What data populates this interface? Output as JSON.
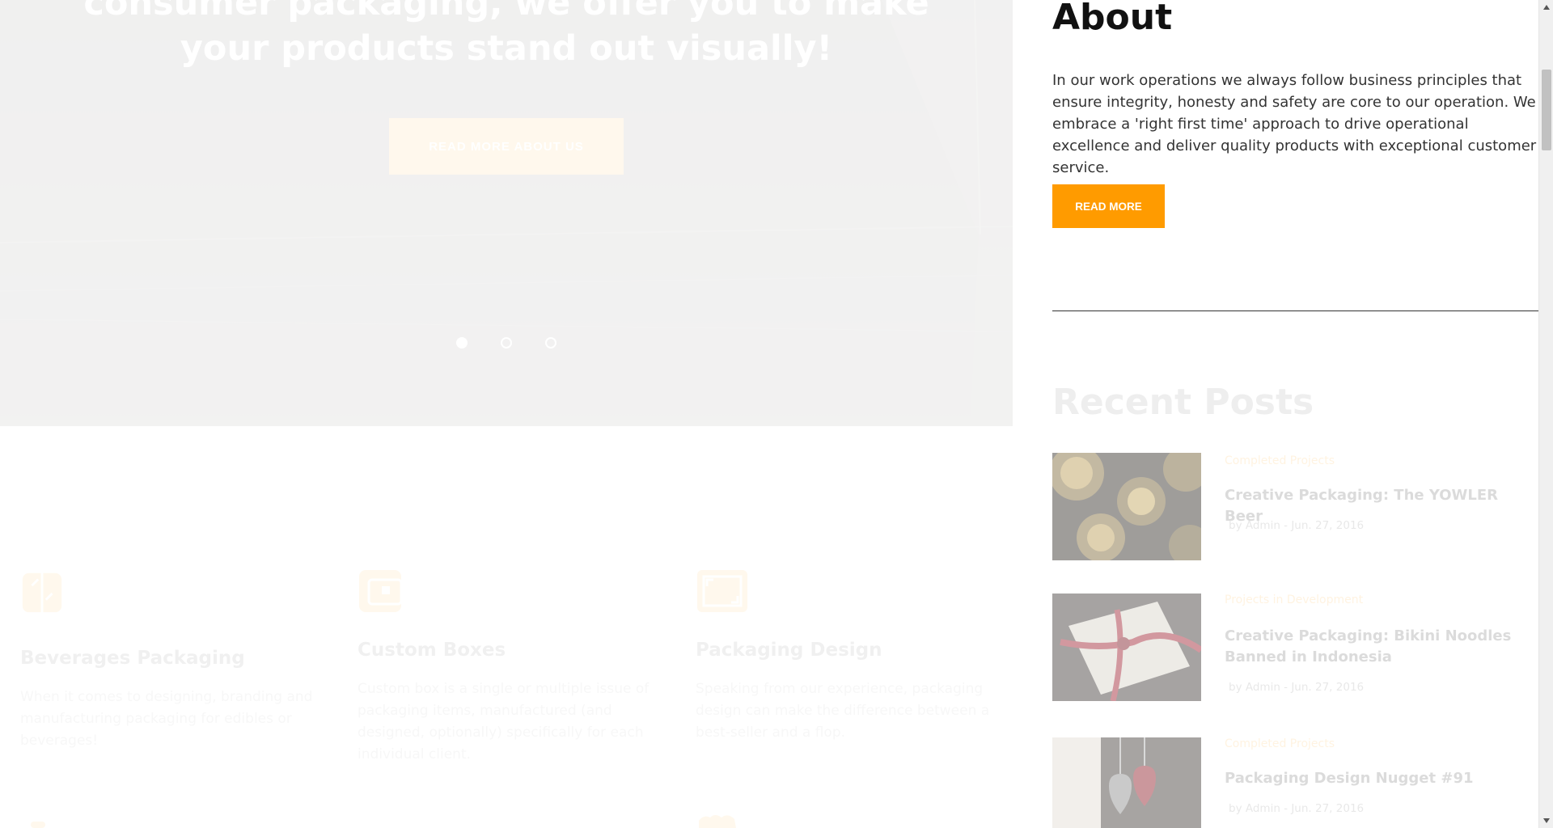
{
  "hero": {
    "heading": "consumer packaging, we offer you to make your products stand out visually!",
    "button_label": "READ MORE ABOUT US",
    "slides": [
      {
        "active": true
      },
      {
        "active": false
      },
      {
        "active": false
      }
    ]
  },
  "services": [
    {
      "icon": "beverage-icon",
      "title": "Beverages Packaging",
      "text": "When it comes to designing, branding and manufacturing packaging for edibles or beverages!"
    },
    {
      "icon": "wallet-box-icon",
      "title": "Custom Boxes",
      "text": "Custom box is a single or multiple issue of packaging items, manufactured (and designed, optionally) specifically for each individual client."
    },
    {
      "icon": "frame-design-icon",
      "title": "Packaging Design",
      "text": "Speaking from our experience, packaging design can make the difference between a best-seller and a flop."
    }
  ],
  "about": {
    "title": "About",
    "text": "In our work operations we always follow business principles that ensure integrity, honesty and safety are core to our operation. We embrace a 'right first time' approach to drive operational excellence and deliver quality products with exceptional customer service.",
    "button_label": "READ MORE"
  },
  "recent_posts": {
    "title": "Recent Posts",
    "items": [
      {
        "category": "Completed Projects",
        "title": "Creative Packaging: The YOWLER Beer",
        "meta": "by Admin - Jun. 27, 2016",
        "thumb": "beer-cans-photo"
      },
      {
        "category": "Projects in Development",
        "title": "Creative Packaging: Bikini Noodles Banned in Indonesia",
        "meta": "by Admin - Jun. 27, 2016",
        "thumb": "ribbon-envelope-photo"
      },
      {
        "category": "Completed Projects",
        "title": "Packaging Design Nugget #91",
        "meta": "by Admin - Jun. 27, 2016",
        "thumb": "hearts-photo"
      }
    ]
  },
  "colors": {
    "accent": "#ff9b00",
    "text_dark": "#111111",
    "text_body": "#333333"
  }
}
